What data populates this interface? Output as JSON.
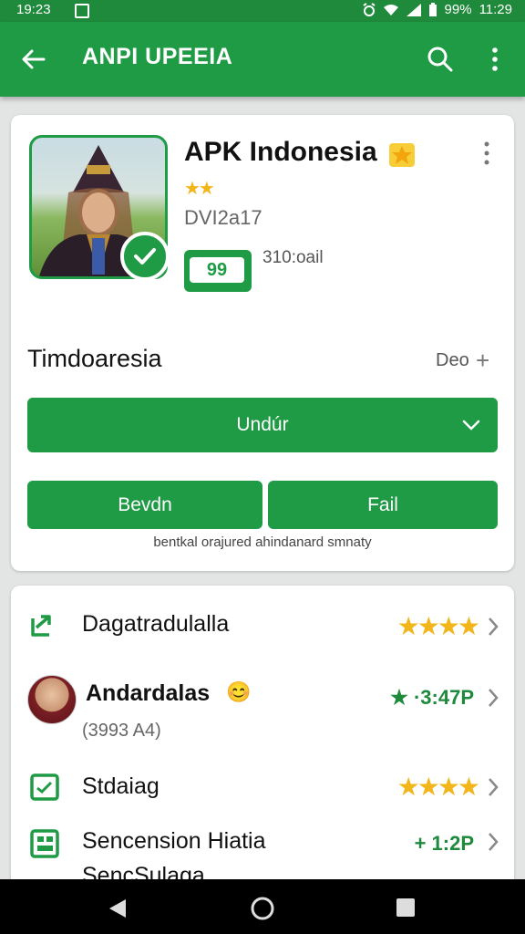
{
  "status_bar": {
    "time": "19:23",
    "battery": "99%",
    "clock_right": "11:29"
  },
  "app_bar": {
    "title": "ANPI UPEEIA"
  },
  "app_card": {
    "name": "APK Indonesia",
    "version": "DVI2a17",
    "download_badge": "99",
    "download_size": "310:oail",
    "section_title": "Timdoaresia",
    "section_more": "Deo",
    "primary_button": "Undúr",
    "button_left": "Bevdn",
    "button_right": "Fail",
    "note": "bentkal orajured ahindanard smnaty"
  },
  "list": [
    {
      "label": "Dagatradulalla",
      "icon": "share-arrow-icon",
      "stars": "★★★★"
    },
    {
      "label": "Andardalas",
      "sublabel": "(3993 A4)",
      "emoji": "😊",
      "rating": "★ ·3:47P"
    },
    {
      "label": "Stdaiag",
      "icon": "chart-box-icon",
      "stars": "★★★★"
    },
    {
      "label": "Sencension Hiatia",
      "sublabel": "SencSulaga",
      "icon": "calculator-icon",
      "rating": "+ 1:2P"
    }
  ],
  "colors": {
    "primary": "#1f9a45",
    "star": "#f2b51a"
  }
}
